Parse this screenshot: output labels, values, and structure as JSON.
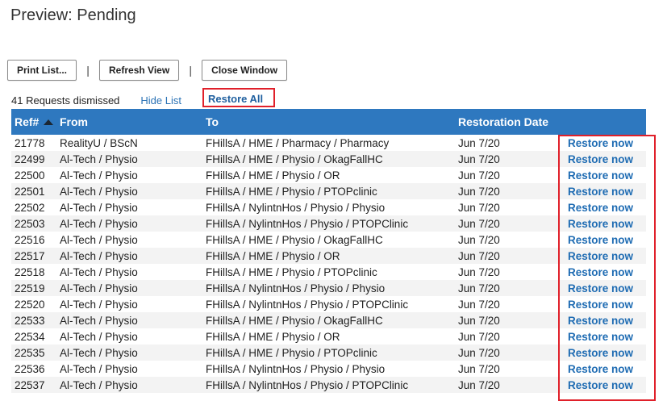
{
  "page": {
    "title": "Preview: Pending"
  },
  "toolbar": {
    "print_label": "Print List...",
    "separator": "|",
    "refresh_label": "Refresh View",
    "close_label": "Close Window"
  },
  "status": {
    "dismissed_text": "41 Requests dismissed",
    "hide_label": "Hide List",
    "restore_all_label": "Restore All"
  },
  "table": {
    "headers": {
      "ref": "Ref#",
      "from": "From",
      "to": "To",
      "date": "Restoration Date"
    },
    "action_label": "Restore now",
    "rows": [
      {
        "ref": "21778",
        "from": "RealityU / BScN",
        "to": "FHillsA / HME / Pharmacy / Pharmacy",
        "date": "Jun 7/20"
      },
      {
        "ref": "22499",
        "from": "Al-Tech / Physio",
        "to": "FHillsA / HME / Physio / OkagFallHC",
        "date": "Jun 7/20"
      },
      {
        "ref": "22500",
        "from": "Al-Tech / Physio",
        "to": "FHillsA / HME / Physio / OR",
        "date": "Jun 7/20"
      },
      {
        "ref": "22501",
        "from": "Al-Tech / Physio",
        "to": "FHillsA / HME / Physio / PTOPclinic",
        "date": "Jun 7/20"
      },
      {
        "ref": "22502",
        "from": "Al-Tech / Physio",
        "to": "FHillsA / NylintnHos / Physio / Physio",
        "date": "Jun 7/20"
      },
      {
        "ref": "22503",
        "from": "Al-Tech / Physio",
        "to": "FHillsA / NylintnHos / Physio / PTOPClinic",
        "date": "Jun 7/20"
      },
      {
        "ref": "22516",
        "from": "Al-Tech / Physio",
        "to": "FHillsA / HME / Physio / OkagFallHC",
        "date": "Jun 7/20"
      },
      {
        "ref": "22517",
        "from": "Al-Tech / Physio",
        "to": "FHillsA / HME / Physio / OR",
        "date": "Jun 7/20"
      },
      {
        "ref": "22518",
        "from": "Al-Tech / Physio",
        "to": "FHillsA / HME / Physio / PTOPclinic",
        "date": "Jun 7/20"
      },
      {
        "ref": "22519",
        "from": "Al-Tech / Physio",
        "to": "FHillsA / NylintnHos / Physio / Physio",
        "date": "Jun 7/20"
      },
      {
        "ref": "22520",
        "from": "Al-Tech / Physio",
        "to": "FHillsA / NylintnHos / Physio / PTOPClinic",
        "date": "Jun 7/20"
      },
      {
        "ref": "22533",
        "from": "Al-Tech / Physio",
        "to": "FHillsA / HME / Physio / OkagFallHC",
        "date": "Jun 7/20"
      },
      {
        "ref": "22534",
        "from": "Al-Tech / Physio",
        "to": "FHillsA / HME / Physio / OR",
        "date": "Jun 7/20"
      },
      {
        "ref": "22535",
        "from": "Al-Tech / Physio",
        "to": "FHillsA / HME / Physio / PTOPclinic",
        "date": "Jun 7/20"
      },
      {
        "ref": "22536",
        "from": "Al-Tech / Physio",
        "to": "FHillsA / NylintnHos / Physio / Physio",
        "date": "Jun 7/20"
      },
      {
        "ref": "22537",
        "from": "Al-Tech / Physio",
        "to": "FHillsA / NylintnHos / Physio / PTOPClinic",
        "date": "Jun 7/20"
      }
    ]
  }
}
